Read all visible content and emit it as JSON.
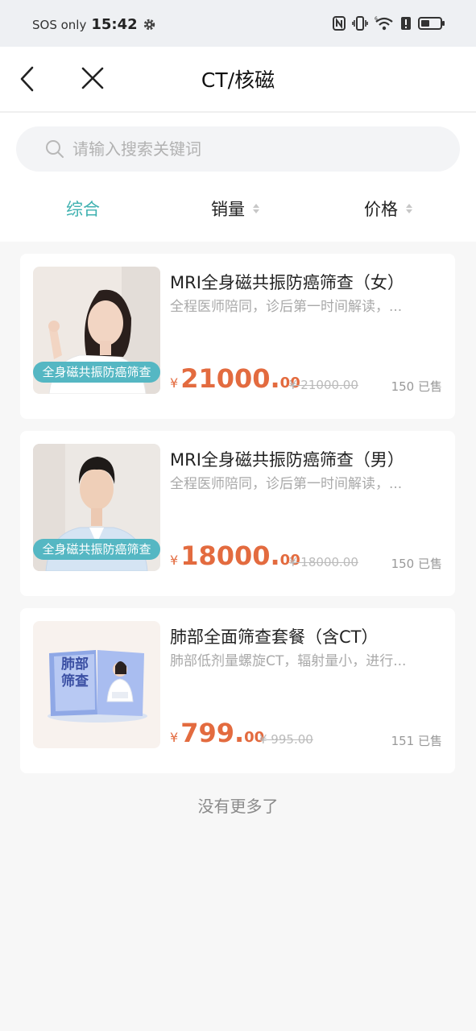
{
  "status_bar": {
    "carrier": "SOS only",
    "time": "15:42"
  },
  "nav": {
    "title": "CT/核磁"
  },
  "search": {
    "placeholder": "请输入搜索关键词"
  },
  "sort_tabs": [
    {
      "label": "综合",
      "active": true
    },
    {
      "label": "销量",
      "active": false
    },
    {
      "label": "价格",
      "active": false
    }
  ],
  "products": [
    {
      "name": "MRI全身磁共振防癌筛查（女）",
      "description": "全程医师陪同，诊后第一时间解读，...",
      "badge": "全身磁共振防癌筛查",
      "currency": "¥",
      "price_int": "21000.",
      "price_dec": "00",
      "original_price": "¥ 21000.00",
      "sold": "150 已售"
    },
    {
      "name": "MRI全身磁共振防癌筛查（男）",
      "description": "全程医师陪同，诊后第一时间解读，...",
      "badge": "全身磁共振防癌筛查",
      "currency": "¥",
      "price_int": "18000.",
      "price_dec": "00",
      "original_price": "¥ 18000.00",
      "sold": "150 已售"
    },
    {
      "name": "肺部全面筛查套餐（含CT）",
      "description": "肺部低剂量螺旋CT，辐射量小，进行...",
      "book_label_1": "肺部",
      "book_label_2": "筛查",
      "currency": "¥",
      "price_int": "799.",
      "price_dec": "00",
      "original_price": "¥ 995.00",
      "sold": "151 已售"
    }
  ],
  "footer": {
    "no_more": "没有更多了"
  },
  "colors": {
    "accent": "#3fb1b0",
    "price": "#e36b3f",
    "badge": "#55b7c3"
  }
}
